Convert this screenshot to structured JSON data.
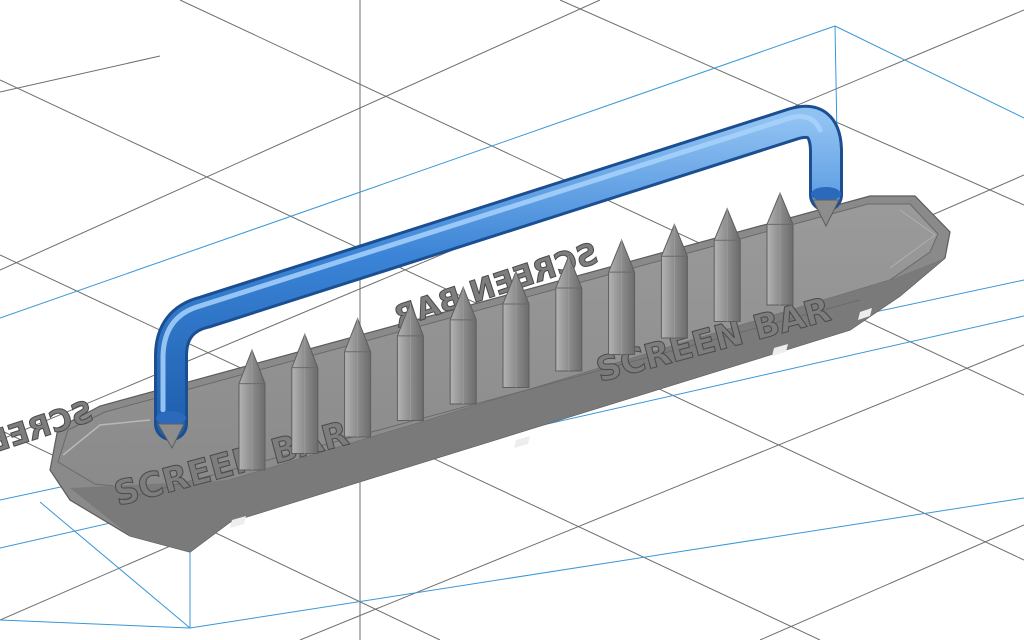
{
  "viewport": {
    "title": "3D build plate viewport",
    "background": "#ffffff",
    "grid_color": "#595959",
    "build_volume_color": "#2f8fd0"
  },
  "model": {
    "body_color": "#8f8f8f",
    "shade_dark": "#6f6f6f",
    "shade_light": "#a8a8a8",
    "handle_color": "#2f78cf",
    "spike_count": 11,
    "embossed_text": {
      "front_left": "SCREEN BAR",
      "front_right": "SCREEN BAR",
      "back_left": "SCREEN BAR",
      "back_right": "SCREEN BAR"
    }
  }
}
